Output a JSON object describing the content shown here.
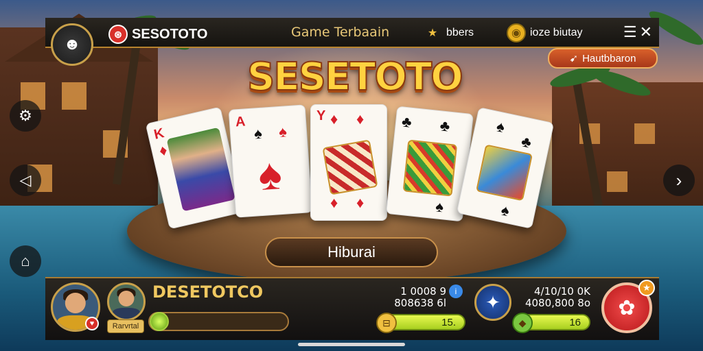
{
  "topbar": {
    "brand": "SESOTOTO",
    "game_title": "Game Terbaain",
    "chip1_label": "bbers",
    "chip2_label": "ioze biutay",
    "menu_icon": "☰✕"
  },
  "banner": {
    "label": "Hautbbaron"
  },
  "hero": {
    "title": "SESETOTO"
  },
  "center": {
    "button_label": "Hiburai"
  },
  "player": {
    "name": "DESETOTCO",
    "tag": "Rarvrtal",
    "xp_progress": 0.05
  },
  "stats": {
    "left_line1": "1 0008 9",
    "left_line2": "808638 6l",
    "left_pill": "15.",
    "right_line1": "4/10/10 0K",
    "right_line2": "4080,800 8o",
    "right_pill": "16"
  },
  "cards": [
    {
      "rank": "K",
      "suit": "♦",
      "color": "red"
    },
    {
      "rank": "A",
      "suit": "♠",
      "color": "red"
    },
    {
      "rank": "Y",
      "suit": "♦",
      "color": "red"
    },
    {
      "rank": "",
      "suit": "♣",
      "color": "black"
    },
    {
      "rank": "",
      "suit": "♠",
      "color": "black"
    }
  ],
  "colors": {
    "accent_gold": "#c8a04a",
    "title_yellow": "#ffd240",
    "action_red": "#e03030"
  }
}
